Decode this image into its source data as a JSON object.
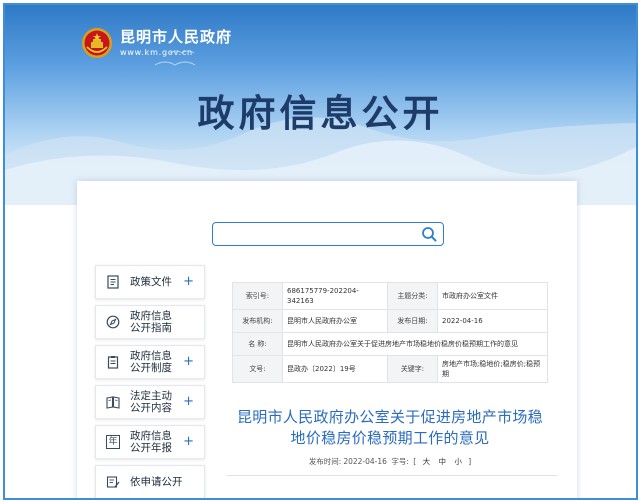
{
  "header": {
    "site_title": "昆明市人民政府",
    "site_url": "www.km.gov.cn",
    "page_title": "政府信息公开"
  },
  "search": {
    "value": "",
    "placeholder": ""
  },
  "sidebar": {
    "items": [
      {
        "label": "政策文件",
        "icon": "document-icon",
        "expandable": true
      },
      {
        "label": "政府信息\n公开指南",
        "icon": "compass-icon",
        "expandable": false
      },
      {
        "label": "政府信息\n公开制度",
        "icon": "clipboard-icon",
        "expandable": true
      },
      {
        "label": "法定主动\n公开内容",
        "icon": "book-icon",
        "expandable": true
      },
      {
        "label": "政府信息\n公开年报",
        "icon": "year-icon",
        "expandable": true
      },
      {
        "label": "依申请公开",
        "icon": "form-edit-icon",
        "expandable": false
      }
    ],
    "plus_symbol": "+",
    "year_glyph": "年"
  },
  "meta": {
    "index_label": "索引号:",
    "index_value": "686175779-202204-342163",
    "category_label": "主题分类:",
    "category_value": "市政府办公室文件",
    "issuer_label": "发布机构:",
    "issuer_value": "昆明市人民政府办公室",
    "date_label": "发布日期:",
    "date_value": "2022-04-16",
    "name_label": "名 称:",
    "name_value": "昆明市人民政府办公室关于促进房地产市场稳地价稳房价稳预期工作的意见",
    "docno_label": "文号:",
    "docno_value": "昆政办〔2022〕19号",
    "keyword_label": "关键字:",
    "keyword_value": "房地产市场;稳地价;稳房价;稳预期"
  },
  "document": {
    "title": "昆明市人民政府办公室关于促进房地产市场稳地价稳房价稳预期工作的意见",
    "publish_label": "发布时间:",
    "publish_date": "2022-04-16",
    "fontsize_label": "字号:",
    "bracket_open": "[",
    "bracket_close": "]",
    "size_large": "大",
    "size_medium": "中",
    "size_small": "小"
  },
  "colors": {
    "accent": "#2e7ed2",
    "title_blue": "#2a6cc0",
    "banner_dark": "#1e3c6a"
  }
}
